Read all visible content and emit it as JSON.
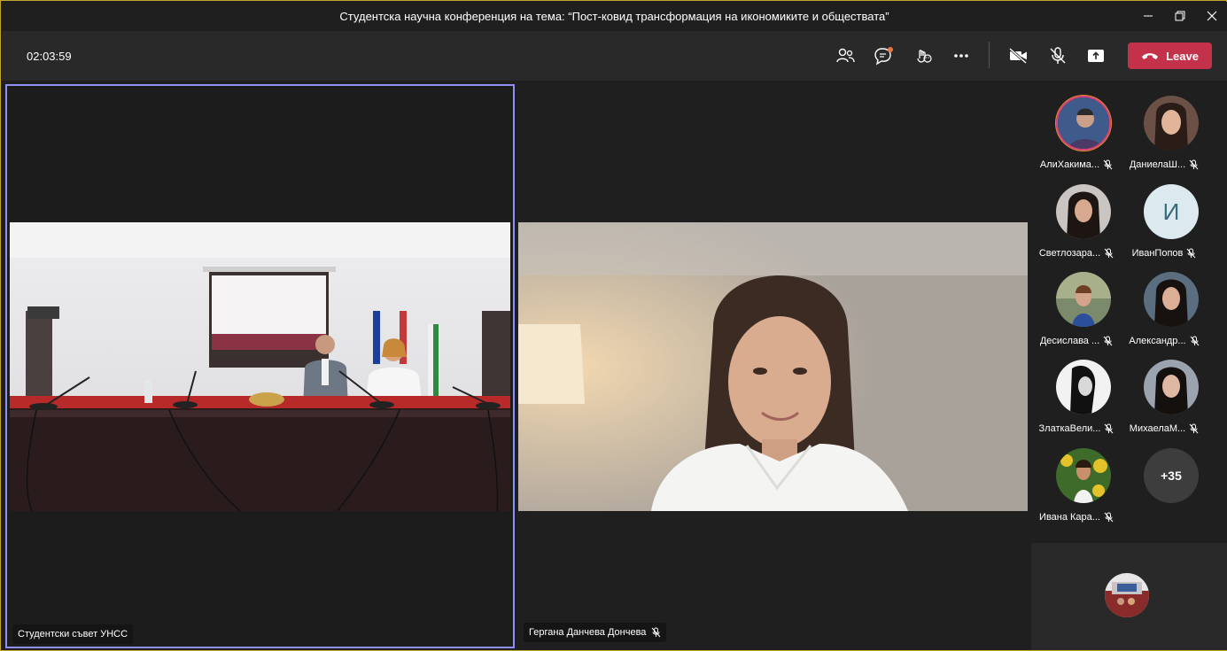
{
  "window": {
    "title": "Студентска научна конференция на тема: “Пост-ковид трансформация на икономиките и обществата”",
    "controls": [
      "minimize-icon",
      "restore-icon",
      "close-icon"
    ]
  },
  "toolbar": {
    "timer": "02:03:59",
    "buttons": [
      "people-icon",
      "chat-icon",
      "reactions-icon",
      "more-icon",
      "camera-off-icon",
      "mic-off-icon",
      "share-screen-icon"
    ],
    "leave_label": "Leave",
    "leave_color": "#c4314b"
  },
  "stage": {
    "tiles": [
      {
        "name": "Студентски съвет УНСС",
        "active": true,
        "muted": false
      },
      {
        "name": "Гергана Данчева Дончева",
        "active": false,
        "muted": true
      }
    ],
    "active_border_color": "#8f90f5"
  },
  "participants": [
    {
      "name": "АлиХакима...",
      "muted": true
    },
    {
      "name": "ДаниелаШ...",
      "muted": true
    },
    {
      "name": "Светлозара...",
      "muted": true
    },
    {
      "name": "ИванПопов",
      "muted": true,
      "initial": "И"
    },
    {
      "name": "Десислава ...",
      "muted": true
    },
    {
      "name": "Александр...",
      "muted": true
    },
    {
      "name": "ЗлаткаВели...",
      "muted": true
    },
    {
      "name": "МихаелаМ...",
      "muted": true
    },
    {
      "name": "Ивана Кара...",
      "muted": true
    }
  ],
  "overflow_count": "+35"
}
